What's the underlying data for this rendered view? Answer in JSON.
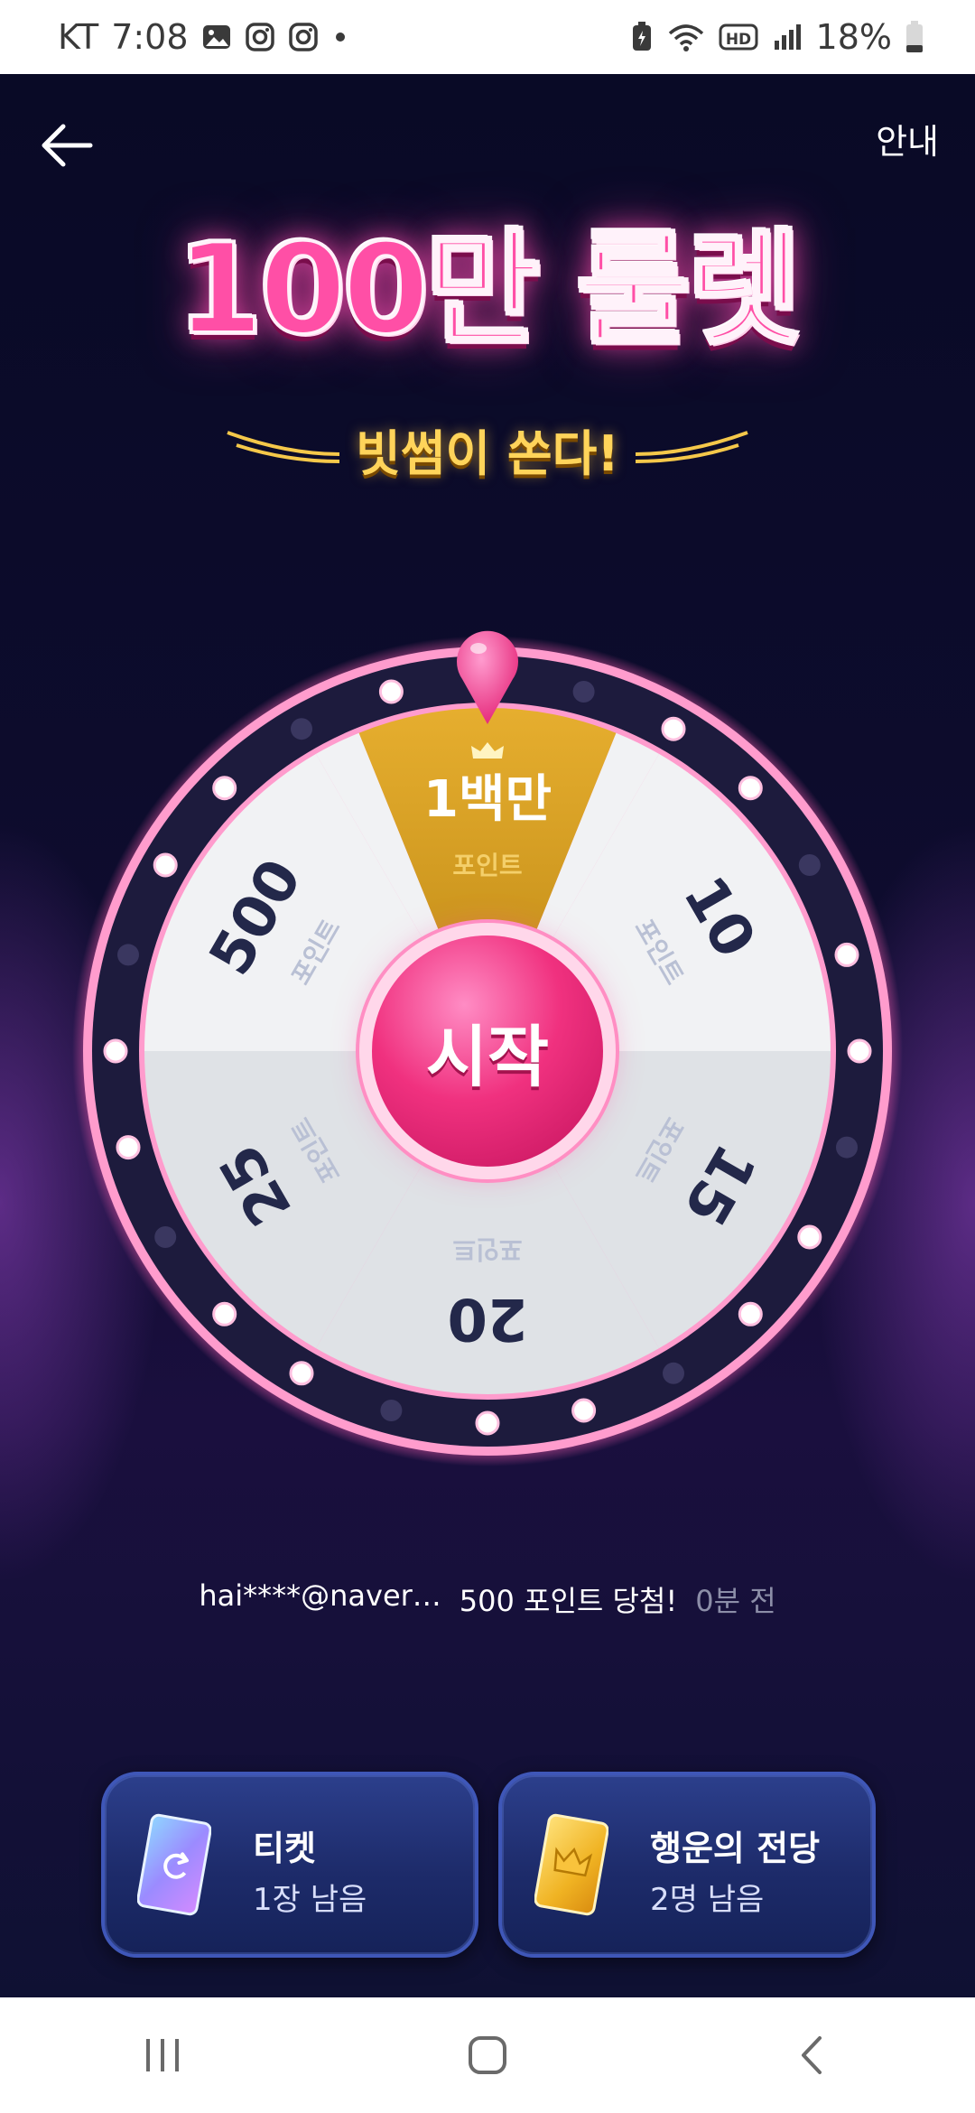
{
  "status_bar": {
    "carrier": "KT",
    "time": "7:08",
    "battery": "18%",
    "left_icons": [
      "gallery-icon",
      "instagram-icon",
      "instagram-icon",
      "dot-icon"
    ],
    "right_icons": [
      "battery-saver-icon",
      "wifi-icon",
      "hd-voice-icon",
      "signal-icon",
      "battery-icon"
    ]
  },
  "header": {
    "back_icon": "arrow-left-icon",
    "info_label": "안내"
  },
  "banner": {
    "title": "100만 룰렛",
    "subtitle": "빗썸이 쏜다!"
  },
  "wheel": {
    "start_label": "시작",
    "segments": [
      {
        "value": "1백만",
        "unit": "포인트",
        "highlight": true
      },
      {
        "value": "10",
        "unit": "포인트"
      },
      {
        "value": "15",
        "unit": "포인트"
      },
      {
        "value": "20",
        "unit": "포인트"
      },
      {
        "value": "25",
        "unit": "포인트"
      },
      {
        "value": "500",
        "unit": "포인트"
      }
    ],
    "colors": {
      "highlight": "#d9a423",
      "segment_light": "#f1f2f4",
      "segment_gray": "#dfe2e6",
      "ring": "#1d1b3d",
      "rim": "#ff8ec8",
      "button": "#f0317f"
    }
  },
  "ticker": {
    "user": "hai****@naver…",
    "prize": "500 포인트 당첨!",
    "time": "0분 전"
  },
  "cards": {
    "ticket": {
      "title": "티켓",
      "sub": "1장 남음",
      "icon": "ticket-card-icon"
    },
    "hall": {
      "title": "행운의 전당",
      "sub": "2명 남음",
      "icon": "crown-card-icon"
    }
  },
  "nav": {
    "recent_icon": "recent-apps-icon",
    "home_icon": "home-icon",
    "back_icon": "nav-back-icon"
  }
}
